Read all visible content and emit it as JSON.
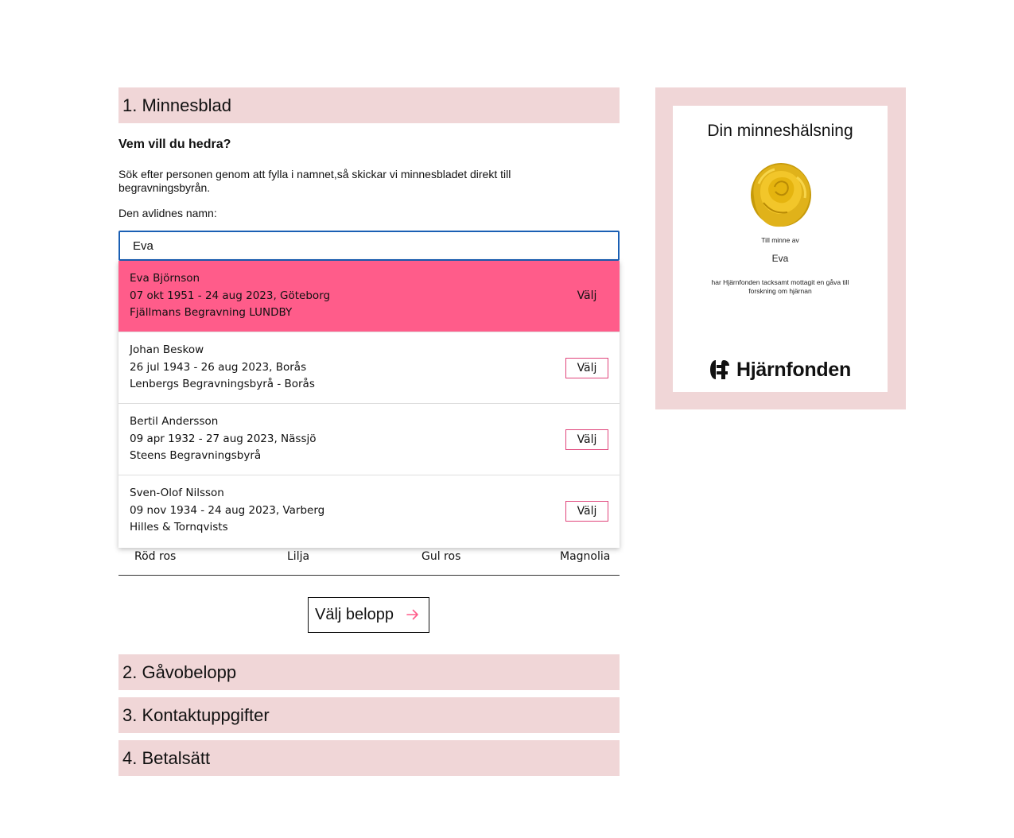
{
  "steps": {
    "step1": "1. Minnesblad",
    "step2": "2. Gåvobelopp",
    "step3": "3. Kontaktuppgifter",
    "step4": "4. Betalsätt"
  },
  "form": {
    "question": "Vem vill du hedra?",
    "description": "Sök efter personen genom att fylla i namnet,så skickar vi minnesbladet direkt till begravningsbyrån.",
    "field_label": "Den avlidnes namn:",
    "search_value": "Eva"
  },
  "results": [
    {
      "name": "Eva Björnson",
      "dates": "07 okt 1951 - 24 aug 2023, Göteborg",
      "agency": "Fjällmans Begravning LUNDBY",
      "button": "Välj",
      "active": true
    },
    {
      "name": "Johan Beskow",
      "dates": "26 jul 1943 - 26 aug 2023, Borås",
      "agency": "Lenbergs Begravningsbyrå - Borås",
      "button": "Välj",
      "active": false
    },
    {
      "name": "Bertil Andersson",
      "dates": "09 apr 1932 - 27 aug 2023, Nässjö",
      "agency": "Steens Begravningsbyrå",
      "button": "Välj",
      "active": false
    },
    {
      "name": "Sven-Olof Nilsson",
      "dates": "09 nov 1934 - 24 aug 2023, Varberg",
      "agency": "Hilles & Tornqvists",
      "button": "Välj",
      "active": false
    }
  ],
  "flowers": [
    "Röd ros",
    "Lilja",
    "Gul ros",
    "Magnolia"
  ],
  "amount_button": "Välj belopp",
  "preview": {
    "title": "Din minneshälsning",
    "in_memory": "Till minne av",
    "name": "Eva",
    "thanks": "har Hjärnfonden tacksamt mottagit en gåva till forskning om hjärnan",
    "logo_text": "Hjärnfonden",
    "image": "yellow-rose"
  },
  "colors": {
    "section_bg": "#f0d6d7",
    "accent": "#ff5c8a",
    "button_border": "#e0457b",
    "focus": "#1a5fb4"
  }
}
